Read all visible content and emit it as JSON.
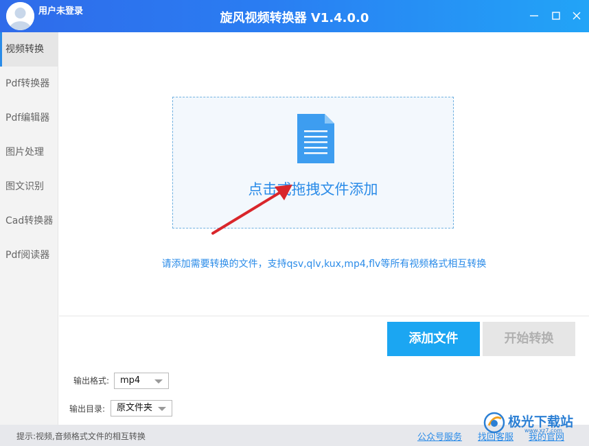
{
  "window": {
    "title": "旋风视频转换器 V1.4.0.0",
    "user_label": "用户未登录"
  },
  "sidebar": {
    "items": [
      {
        "label": "视频转换",
        "active": true
      },
      {
        "label": "Pdf转换器"
      },
      {
        "label": "Pdf编辑器"
      },
      {
        "label": "图片处理"
      },
      {
        "label": "图文识别"
      },
      {
        "label": "Cad转换器"
      },
      {
        "label": "Pdf阅读器"
      }
    ]
  },
  "main": {
    "drop_text": "点击或拖拽文件添加",
    "hint": "请添加需要转换的文件，支持qsv,qlv,kux,mp4,flv等所有视频格式相互转换",
    "add_button": "添加文件",
    "start_button": "开始转换"
  },
  "output": {
    "format_label": "输出格式:",
    "format_value": "mp4",
    "dir_label": "输出目录:",
    "dir_value": "原文件夹"
  },
  "status": {
    "tip": "提示:视频,音频格式文件的相互转换",
    "links": [
      "公众号服务",
      "找回客服",
      "我的官网"
    ]
  },
  "watermark": {
    "text": "极光下载站",
    "url": "www.xz7.com"
  },
  "colors": {
    "accent": "#2a8be8",
    "title_bar_start": "#2f6bea",
    "title_bar_end": "#22a4f7",
    "add_button": "#1ba6f2",
    "arrow": "#d9262b"
  },
  "icons": [
    "avatar-icon",
    "minimize-icon",
    "maximize-icon",
    "close-icon",
    "file-document-icon",
    "dropdown-caret-icon"
  ]
}
